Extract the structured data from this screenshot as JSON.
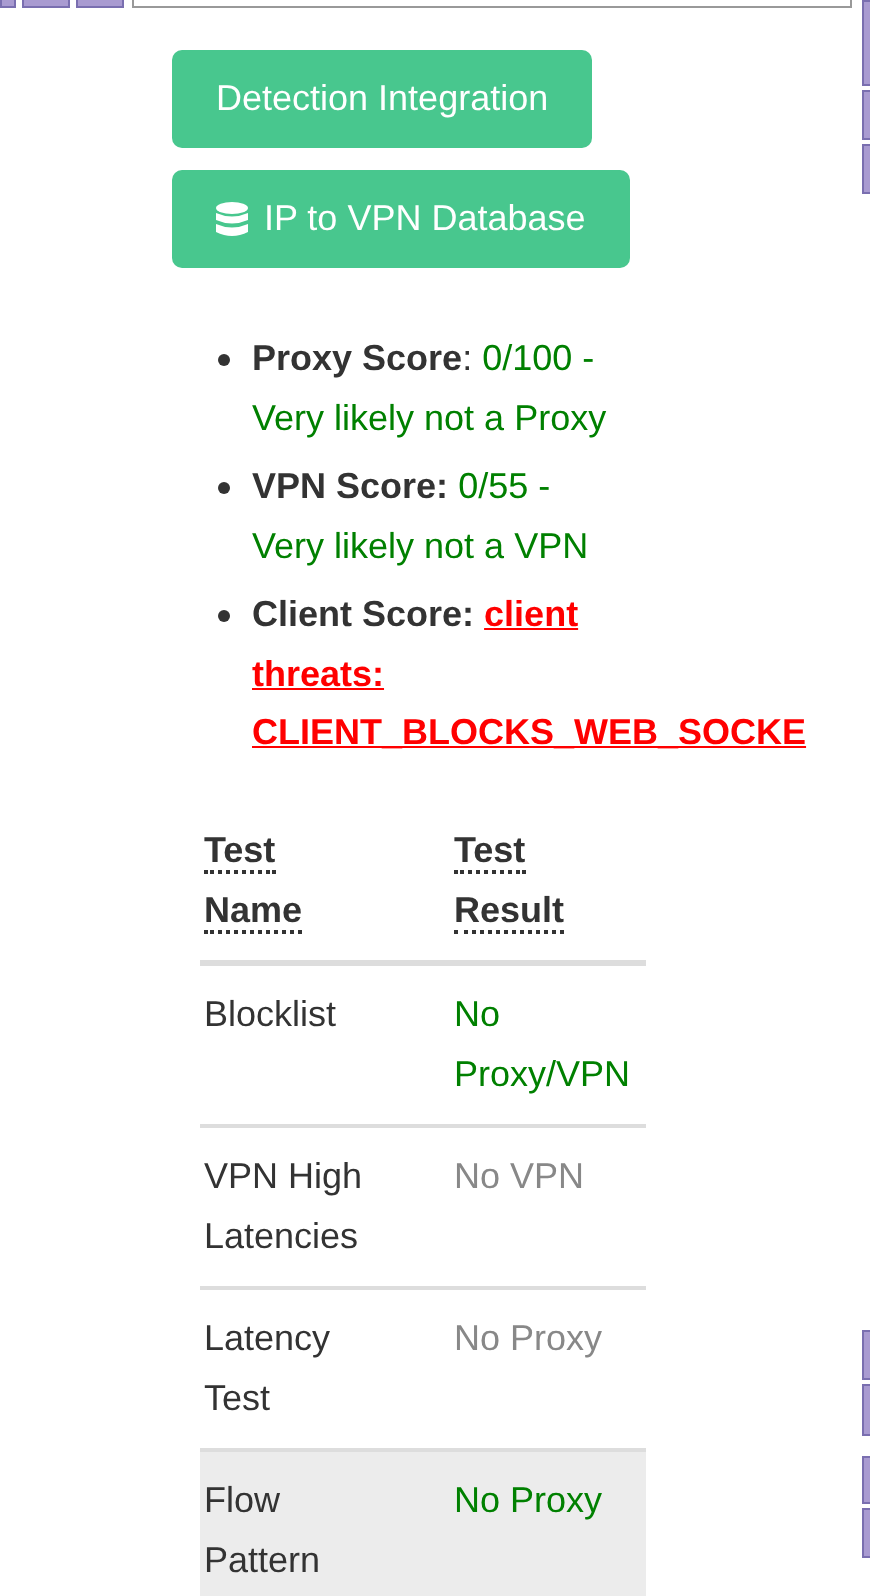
{
  "buttons": [
    {
      "label": "Detection Integration",
      "kind": "plain"
    },
    {
      "label": "IP to VPN Database",
      "kind": "with-icon"
    }
  ],
  "scores": [
    {
      "label": "Proxy Score",
      "separator": ":",
      "value": "0/100 -",
      "verdict": "Very likely not a Proxy",
      "kind": "plain"
    },
    {
      "label": "VPN Score:",
      "value": "0/55 -",
      "verdict": "Very likely not a VPN",
      "kind": "plain"
    },
    {
      "label": "Client Score:",
      "link_lines": [
        "client",
        "threats:",
        "CLIENT_BLOCKS_WEB_SOCKE"
      ],
      "kind": "alert-link"
    }
  ],
  "table": {
    "columns": [
      "Test Name",
      "Test Result"
    ],
    "rows": [
      {
        "name": "Blocklist",
        "result": "No Proxy/VPN",
        "kind": "positive",
        "highlighted": false
      },
      {
        "name": "VPN High Latencies",
        "result": "No VPN",
        "kind": "muted",
        "highlighted": false
      },
      {
        "name": "Latency Test",
        "result": "No Proxy",
        "kind": "muted",
        "highlighted": false
      },
      {
        "name": "Flow Pattern",
        "result": "No Proxy",
        "kind": "positive",
        "highlighted": true
      }
    ]
  }
}
